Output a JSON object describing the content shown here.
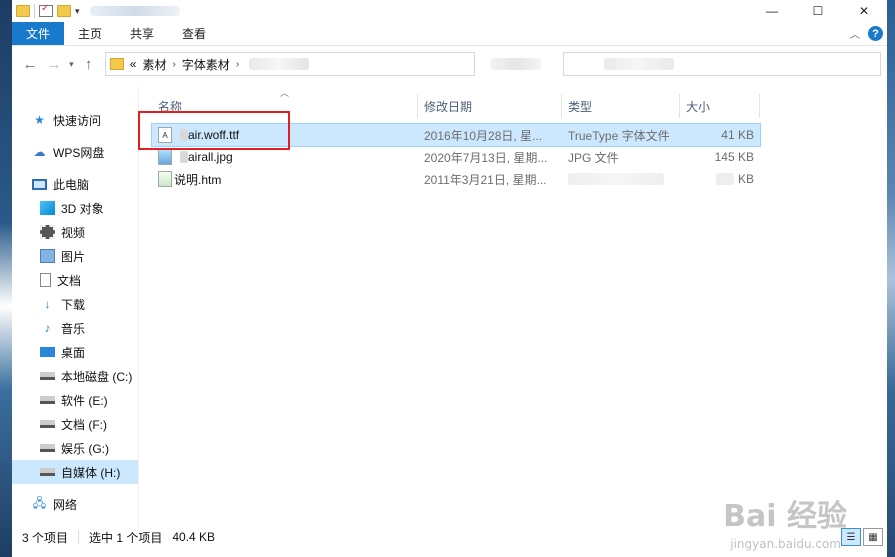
{
  "ribbon": {
    "tabs": [
      "文件",
      "主页",
      "共享",
      "查看"
    ]
  },
  "window_buttons": {
    "minimize": "—",
    "maximize": "☐",
    "close": "✕"
  },
  "address": {
    "prefix": "«",
    "crumbs": [
      "素材",
      "字体素材"
    ]
  },
  "sidebar": {
    "quick_access": "快速访问",
    "wps": "WPS网盘",
    "this_pc": "此电脑",
    "items": [
      "3D 对象",
      "视频",
      "图片",
      "文档",
      "下载",
      "音乐",
      "桌面",
      "本地磁盘 (C:)",
      "软件 (E:)",
      "文档 (F:)",
      "娱乐 (G:)",
      "自媒体 (H:)"
    ],
    "network": "网络"
  },
  "columns": {
    "name": "名称",
    "date": "修改日期",
    "type": "类型",
    "size": "大小"
  },
  "files": [
    {
      "name": "air.woff.ttf",
      "date": "2016年10月28日, 星...",
      "type": "TrueType 字体文件",
      "size": "41 KB"
    },
    {
      "name": "airall.jpg",
      "date": "2020年7月13日, 星期...",
      "type": "JPG 文件",
      "size": "145 KB"
    },
    {
      "name": "说明.htm",
      "date": "2011年3月21日, 星期...",
      "type": "",
      "size": "KB"
    }
  ],
  "status": {
    "count": "3 个项目",
    "selected": "选中 1 个项目",
    "size": "40.4 KB"
  },
  "watermark": {
    "text": "Bai 经验",
    "url": "jingyan.baidu.com"
  }
}
